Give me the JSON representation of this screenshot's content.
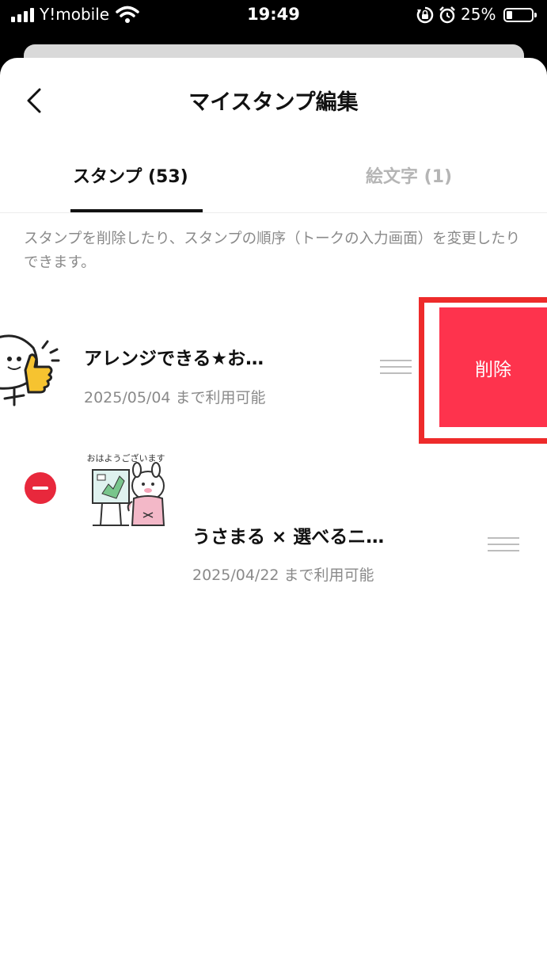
{
  "status_bar": {
    "carrier": "Y!mobile",
    "time": "19:49",
    "battery_percent": "25%",
    "battery_level": 0.25,
    "icons": [
      "signal-icon",
      "wifi-icon",
      "rotation-lock-icon",
      "alarm-icon",
      "battery-icon"
    ]
  },
  "header": {
    "title": "マイスタンプ編集",
    "back_icon": "chevron-left-icon"
  },
  "tabs": [
    {
      "label": "スタンプ (53)",
      "active": true
    },
    {
      "label": "絵文字 (1)",
      "active": false
    }
  ],
  "description": "スタンプを削除したり、スタンプの順序（トークの入力画面）を変更したりできます。",
  "stamps": [
    {
      "name": "アレンジできる★お…",
      "expiry": "2025/05/04 まで利用可能",
      "swiped": true,
      "delete_label": "削除"
    },
    {
      "name": "うさまる × 選べるニ…",
      "expiry": "2025/04/22 まで利用可能",
      "swiped": false,
      "thumb_caption": "おはようございます"
    }
  ],
  "colors": {
    "delete": "#fe334d",
    "remove": "#e8283c",
    "highlight": "#ee2b2b"
  }
}
